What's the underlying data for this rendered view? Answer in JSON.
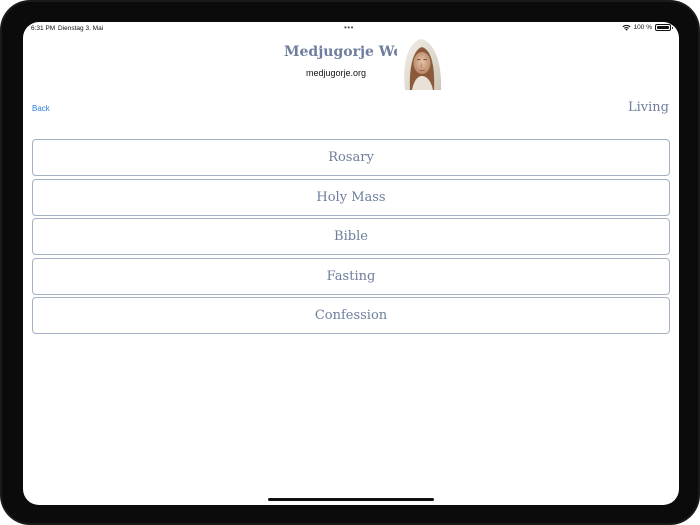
{
  "status_bar": {
    "time": "6:31 PM",
    "date": "Dienstag 3. Mai",
    "dots": "•••",
    "battery_text": "100 %",
    "wifi_icon": "wifi-icon",
    "battery_icon": "battery-icon"
  },
  "header": {
    "title": "Medjugorje Web",
    "subtitle": "medjugorje.org",
    "image_icon": "madonna-image"
  },
  "nav": {
    "back_label": "Back",
    "section_title": "Living"
  },
  "menu": {
    "items": [
      {
        "label": "Rosary"
      },
      {
        "label": "Holy Mass"
      },
      {
        "label": "Bible"
      },
      {
        "label": "Fasting"
      },
      {
        "label": "Confession"
      }
    ]
  },
  "colors": {
    "accent": "#6e7e9c",
    "link": "#2b7fe0",
    "border": "#a6b0c4"
  }
}
